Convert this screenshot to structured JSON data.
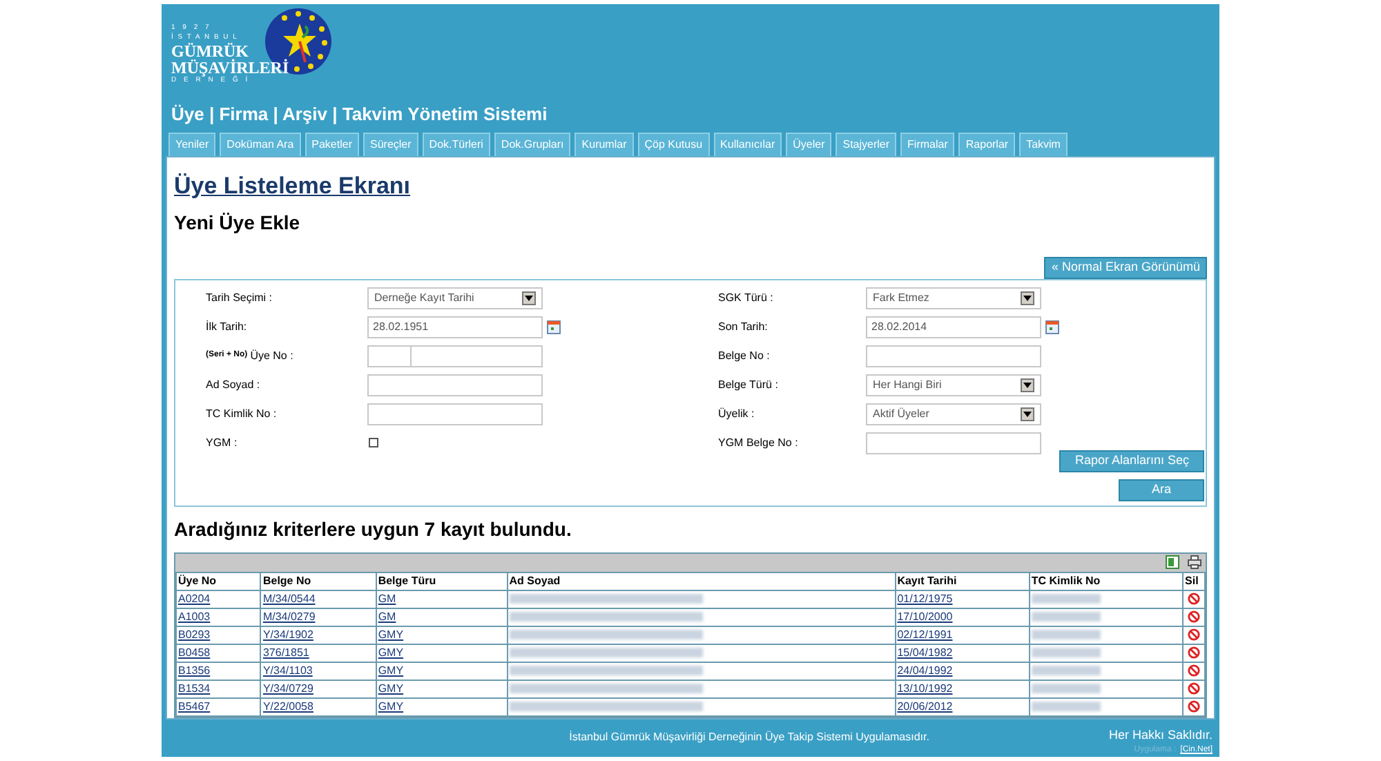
{
  "logo": {
    "lines": [
      "1 9 2 7",
      "İ S T A N B U L",
      "GÜMRÜK",
      "MÜŞAVİRLERİ",
      "D E R N E Ğ İ"
    ]
  },
  "app_title": "Üye | Firma | Arşiv | Takvim Yönetim Sistemi",
  "tabs": [
    {
      "label": "Yeniler",
      "selected": false
    },
    {
      "label": "Doküman Ara",
      "selected": false
    },
    {
      "label": "Paketler",
      "selected": false
    },
    {
      "label": "Süreçler",
      "selected": false
    },
    {
      "label": "Dok.Türleri",
      "selected": false
    },
    {
      "label": "Dok.Grupları",
      "selected": false
    },
    {
      "label": "Kurumlar",
      "selected": false
    },
    {
      "label": "Çöp Kutusu",
      "selected": false
    },
    {
      "label": "Kullanıcılar",
      "selected": false
    },
    {
      "label": "Üyeler",
      "selected": false
    },
    {
      "label": "Stajyerler",
      "selected": false
    },
    {
      "label": "Firmalar",
      "selected": false
    },
    {
      "label": "Raporlar",
      "selected": false
    },
    {
      "label": "Takvim",
      "selected": false
    }
  ],
  "page_title": "Üye Listeleme Ekranı",
  "add_link": "Yeni Üye Ekle",
  "normal_view_button": "« Normal Ekran Görünümü",
  "form": {
    "left": [
      {
        "kind": "select",
        "label": "Tarih Seçimi :",
        "value": "Derneğe Kayıt Tarihi"
      },
      {
        "kind": "date",
        "label": "İlk Tarih:",
        "value": "28.02.1951"
      },
      {
        "kind": "split",
        "prefix": "(Seri + No)",
        "label": "Üye No :"
      },
      {
        "kind": "text",
        "label": "Ad Soyad :"
      },
      {
        "kind": "text",
        "label": "TC Kimlik No :"
      },
      {
        "kind": "checkbox",
        "label": "YGM :",
        "checked": false
      }
    ],
    "right": [
      {
        "kind": "select",
        "label": "SGK Türü :",
        "value": "Fark Etmez"
      },
      {
        "kind": "date",
        "label": "Son Tarih:",
        "value": "28.02.2014"
      },
      {
        "kind": "text",
        "label": "Belge No :"
      },
      {
        "kind": "select",
        "label": "Belge Türü :",
        "value": "Her Hangi Biri"
      },
      {
        "kind": "select",
        "label": "Üyelik :",
        "value": "Aktif Üyeler"
      },
      {
        "kind": "text",
        "label": "YGM Belge No :"
      }
    ],
    "buttons": [
      "Rapor Alanlarını Seç",
      "Ara"
    ]
  },
  "result_text": "Aradığınız kriterlere uygun 7 kayıt bulundu.",
  "table": {
    "columns": [
      "Üye No",
      "Belge No",
      "Belge Türu",
      "Ad Soyad",
      "Kayıt Tarihi",
      "TC Kimlik No",
      "Sil"
    ],
    "rows": [
      {
        "uye_no": "A0204",
        "belge_no": "M/34/0544",
        "belge_turu": "GM",
        "kayit_tarihi": "01/12/1975"
      },
      {
        "uye_no": "A1003",
        "belge_no": "M/34/0279",
        "belge_turu": "GM",
        "kayit_tarihi": "17/10/2000"
      },
      {
        "uye_no": "B0293",
        "belge_no": "Y/34/1902",
        "belge_turu": "GMY",
        "kayit_tarihi": "02/12/1991"
      },
      {
        "uye_no": "B0458",
        "belge_no": "376/1851",
        "belge_turu": "GMY",
        "kayit_tarihi": "15/04/1982"
      },
      {
        "uye_no": "B1356",
        "belge_no": "Y/34/1103",
        "belge_turu": "GMY",
        "kayit_tarihi": "24/04/1992"
      },
      {
        "uye_no": "B1534",
        "belge_no": "Y/34/0729",
        "belge_turu": "GMY",
        "kayit_tarihi": "13/10/1992"
      },
      {
        "uye_no": "B5467",
        "belge_no": "Y/22/0058",
        "belge_turu": "GMY",
        "kayit_tarihi": "20/06/2012"
      }
    ]
  },
  "footer": {
    "text": "İstanbul Gümrük Müşavirliği Derneğinin Üye Takip Sistemi Uygulamasıdır.",
    "rights": "Her Hakkı Saklıdır.",
    "credit_label": "Uygulama :",
    "credit_link": "[Cin.Net]"
  }
}
